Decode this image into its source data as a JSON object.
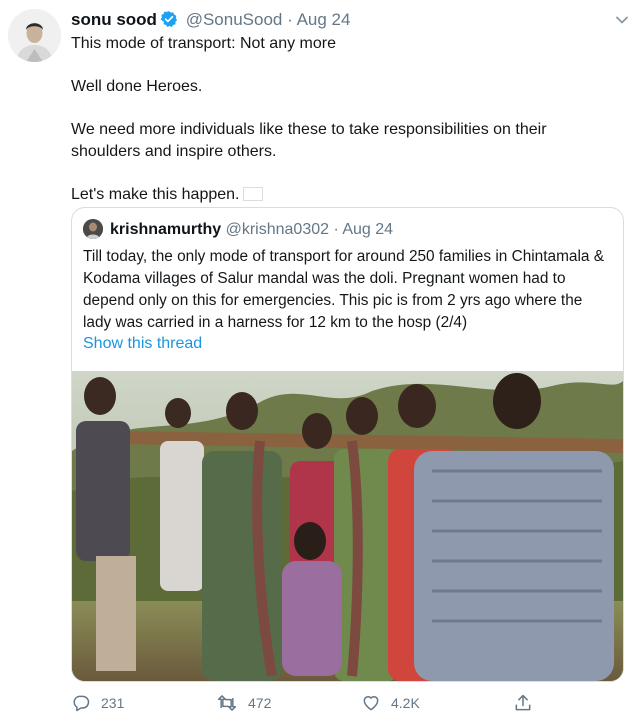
{
  "tweet": {
    "author_name": "sonu sood",
    "handle": "@SonuSood",
    "separator": "·",
    "date": "Aug 24",
    "lines": [
      "This mode of transport: Not any more",
      "Well done Heroes.",
      "We need more individuals like these to take responsibilities on their shoulders and inspire others.",
      "Let's make this happen."
    ],
    "flag_icon": "india-flag-icon"
  },
  "quoted": {
    "author_name": "krishnamurthy",
    "handle": "@krishna0302",
    "separator": "·",
    "date": "Aug 24",
    "text": "Till today, the only mode of transport for around 250 families in Chintamala & Kodama villages of Salur mandal was the doli. Pregnant women had to depend only on this for emergencies. This pic is from 2 yrs ago where the lady was carried in a harness for 12 km to the hosp (2/4)",
    "show_thread": "Show this thread"
  },
  "actions": {
    "replies": "231",
    "retweets": "472",
    "likes": "4.2K"
  },
  "colors": {
    "link": "#1b95e0",
    "muted": "#657786",
    "verified": "#1da1f2",
    "border": "#d7dde2"
  }
}
